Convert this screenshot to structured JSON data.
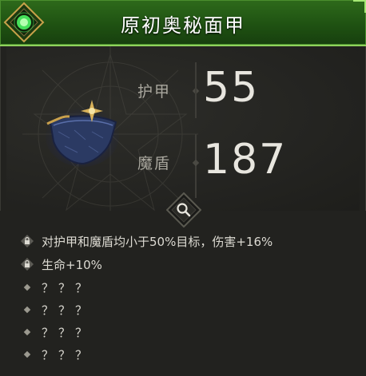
{
  "header": {
    "title": "原初奥秘面甲",
    "accent_color": "#2e6a1b",
    "emblem_icon": "green-gem-emblem-icon"
  },
  "stats": [
    {
      "label": "护甲",
      "value": "55"
    },
    {
      "label": "魔盾",
      "value": "187"
    }
  ],
  "item_icon": "arcane-mask-icon",
  "inspect_icon": "magnifier-icon",
  "modifiers": [
    {
      "locked": true,
      "text": "对护甲和魔盾均小于50%目标，伤害+16%"
    },
    {
      "locked": true,
      "text": "生命+10%"
    },
    {
      "locked": false,
      "text": "？？？"
    },
    {
      "locked": false,
      "text": "？？？"
    },
    {
      "locked": false,
      "text": "？？？"
    },
    {
      "locked": false,
      "text": "？？？"
    }
  ]
}
